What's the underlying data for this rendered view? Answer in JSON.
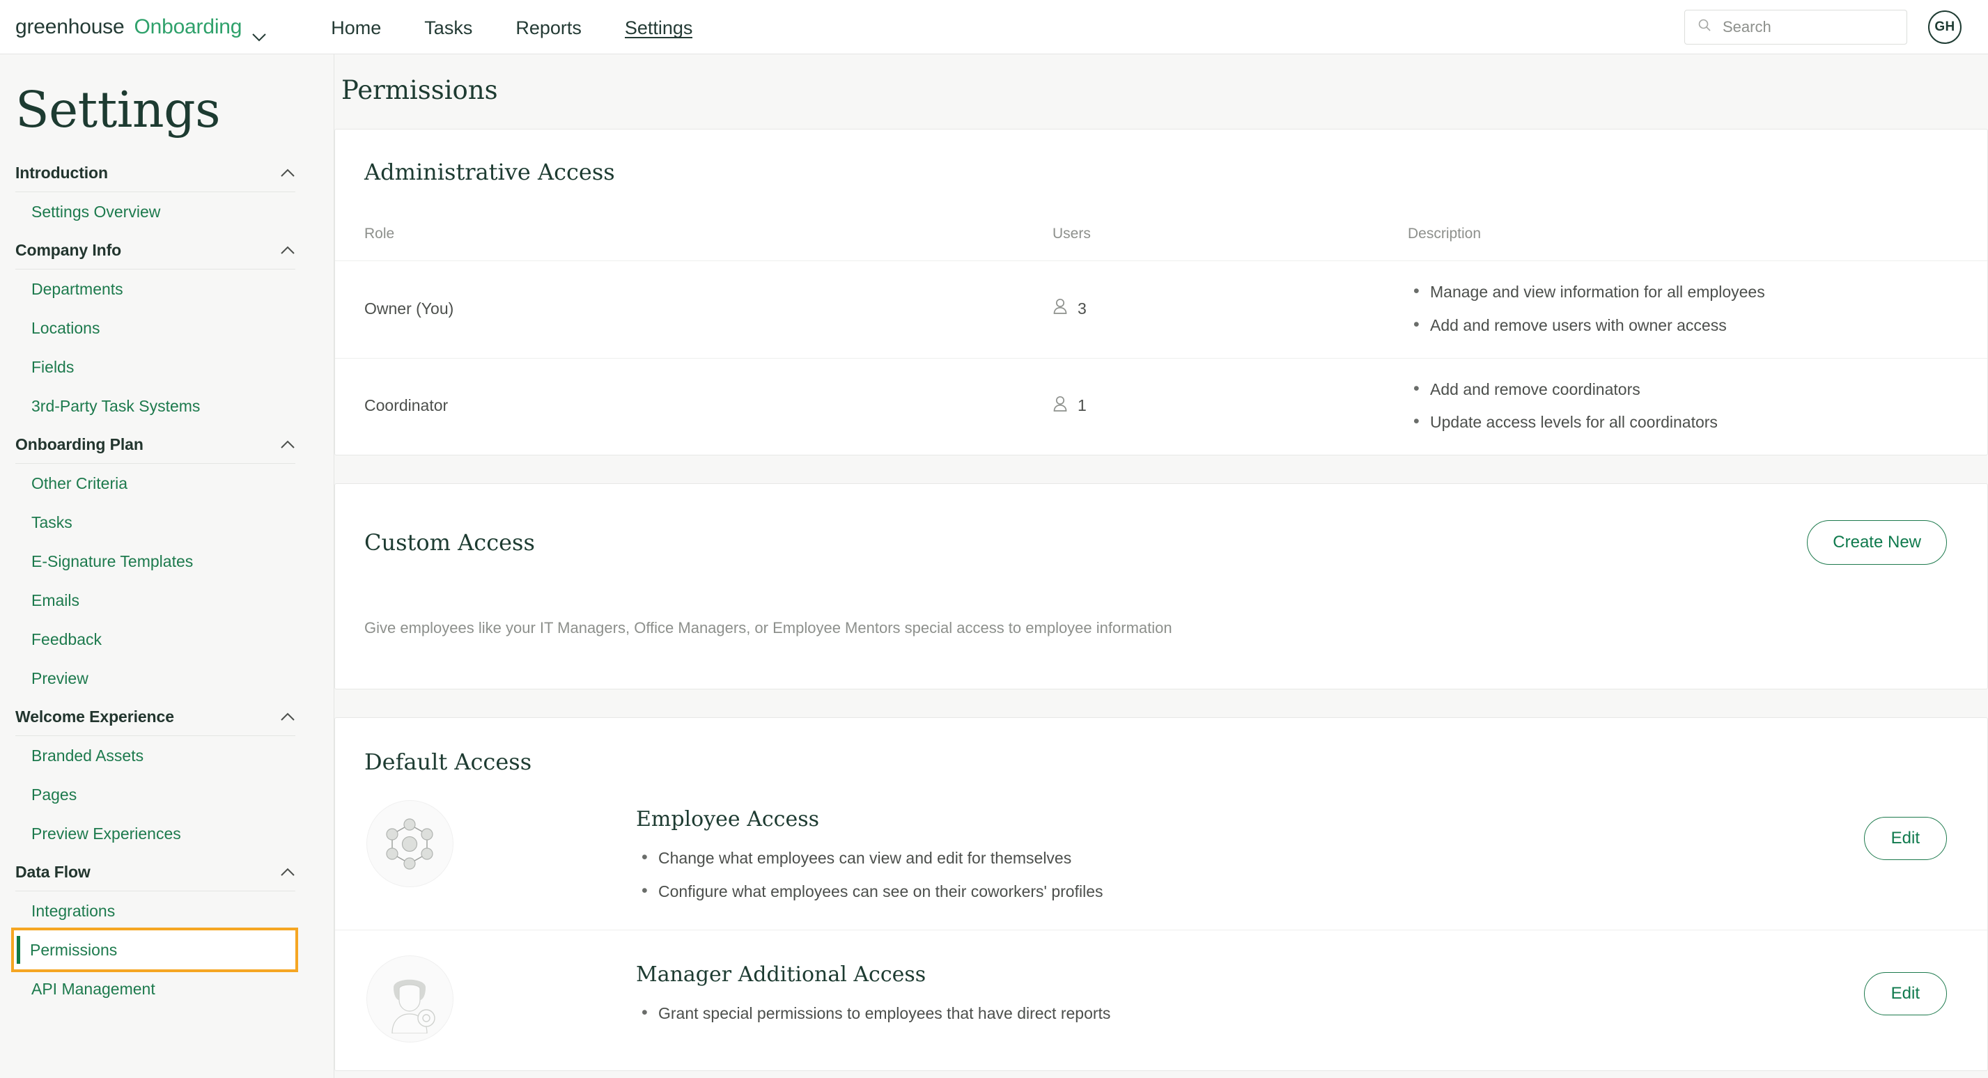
{
  "topbar": {
    "brand_primary": "greenhouse",
    "brand_secondary": "Onboarding",
    "brand_caret_icon": "chevron-down-icon",
    "nav": [
      {
        "label": "Home",
        "active": false
      },
      {
        "label": "Tasks",
        "active": false
      },
      {
        "label": "Reports",
        "active": false
      },
      {
        "label": "Settings",
        "active": true
      }
    ],
    "search": {
      "placeholder": "Search",
      "value": "",
      "icon": "search-icon"
    },
    "avatar": {
      "initials": "GH"
    }
  },
  "sidebar": {
    "page_title": "Settings",
    "groups": [
      {
        "title": "Introduction",
        "caret_icon": "chevron-up-icon",
        "items": [
          {
            "label": "Settings Overview",
            "highlighted": false
          }
        ]
      },
      {
        "title": "Company Info",
        "caret_icon": "chevron-up-icon",
        "items": [
          {
            "label": "Departments",
            "highlighted": false
          },
          {
            "label": "Locations",
            "highlighted": false
          },
          {
            "label": "Fields",
            "highlighted": false
          },
          {
            "label": "3rd-Party Task Systems",
            "highlighted": false
          }
        ]
      },
      {
        "title": "Onboarding Plan",
        "caret_icon": "chevron-up-icon",
        "items": [
          {
            "label": "Other Criteria",
            "highlighted": false
          },
          {
            "label": "Tasks",
            "highlighted": false
          },
          {
            "label": "E-Signature Templates",
            "highlighted": false
          },
          {
            "label": "Emails",
            "highlighted": false
          },
          {
            "label": "Feedback",
            "highlighted": false
          },
          {
            "label": "Preview",
            "highlighted": false
          }
        ]
      },
      {
        "title": "Welcome Experience",
        "caret_icon": "chevron-up-icon",
        "items": [
          {
            "label": "Branded Assets",
            "highlighted": false
          },
          {
            "label": "Pages",
            "highlighted": false
          },
          {
            "label": "Preview Experiences",
            "highlighted": false
          }
        ]
      },
      {
        "title": "Data Flow",
        "caret_icon": "chevron-up-icon",
        "items": [
          {
            "label": "Integrations",
            "highlighted": false
          },
          {
            "label": "Permissions",
            "highlighted": true
          },
          {
            "label": "API Management",
            "highlighted": false
          }
        ]
      }
    ]
  },
  "main": {
    "title": "Permissions",
    "administrative_access": {
      "title": "Administrative Access",
      "columns": [
        "Role",
        "Users",
        "Description"
      ],
      "rows": [
        {
          "role": "Owner (You)",
          "users": "3",
          "users_icon": "user-icon",
          "description": [
            "Manage and view information for all employees",
            "Add and remove users with owner access"
          ]
        },
        {
          "role": "Coordinator",
          "users": "1",
          "users_icon": "user-icon",
          "description": [
            "Add and remove coordinators",
            "Update access levels for all coordinators"
          ]
        }
      ]
    },
    "custom_access": {
      "title": "Custom Access",
      "create_button": "Create New",
      "description": "Give employees like your IT Managers, Office Managers, or Employee Mentors special access to employee information"
    },
    "default_access": {
      "title": "Default Access",
      "rows": [
        {
          "icon": "network-nodes-icon",
          "title": "Employee Access",
          "bullets": [
            "Change what employees can view and edit for themselves",
            "Configure what employees can see on their coworkers' profiles"
          ],
          "edit_label": "Edit"
        },
        {
          "icon": "person-gear-icon",
          "title": "Manager Additional Access",
          "bullets": [
            "Grant special permissions to employees that have direct reports"
          ],
          "edit_label": "Edit"
        }
      ]
    }
  },
  "colors": {
    "brand_green": "#2fa16b",
    "link_green": "#1d7a4d",
    "dark_green": "#1d3b31",
    "highlight_orange": "#f5a623",
    "page_bg": "#f7f7f6"
  }
}
